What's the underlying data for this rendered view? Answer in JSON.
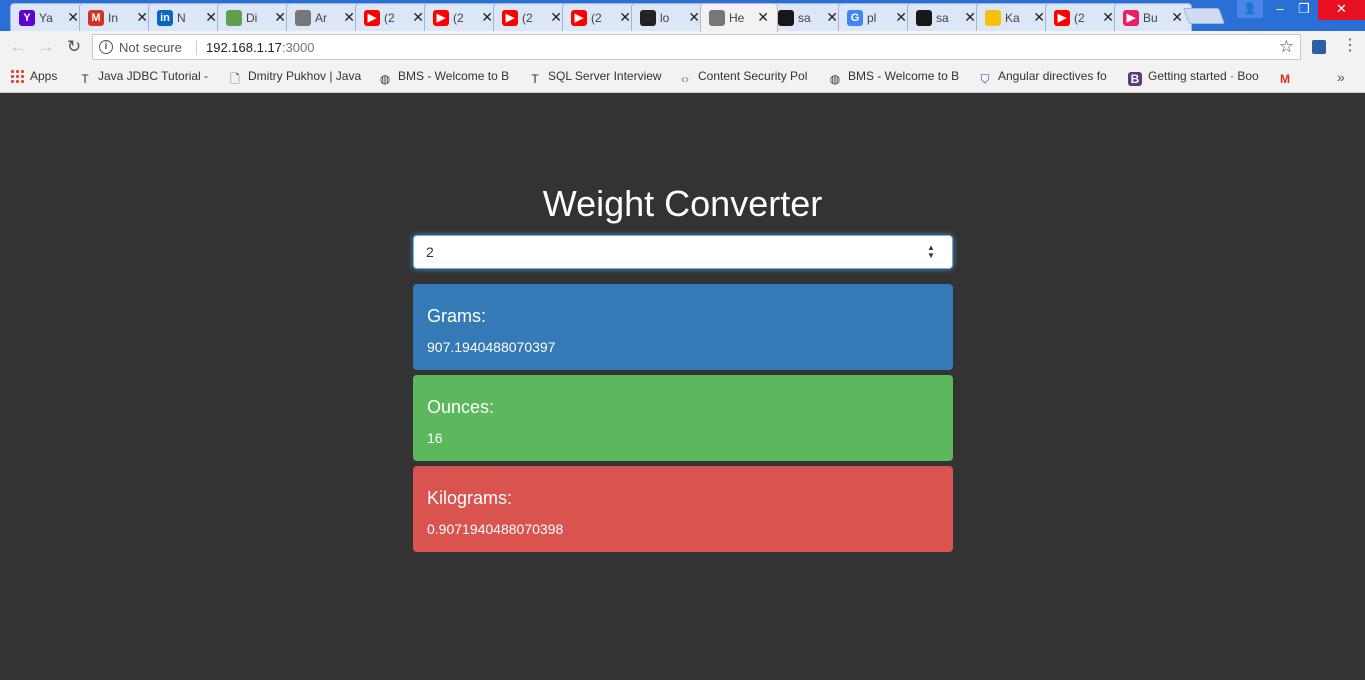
{
  "browser": {
    "tabs": [
      {
        "title": "Ya",
        "favicon": "yahoo-icon",
        "color": "#5f01d1",
        "glyph": "Y"
      },
      {
        "title": "In",
        "favicon": "gmail-icon",
        "color": "#d93025",
        "glyph": "M"
      },
      {
        "title": "N",
        "favicon": "linkedin-icon",
        "color": "#0a66c2",
        "glyph": "in"
      },
      {
        "title": "Di",
        "favicon": "nodejs-icon",
        "color": "#5fa04e",
        "glyph": ""
      },
      {
        "title": "Ar",
        "favicon": "bot-icon",
        "color": "#777777",
        "glyph": ""
      },
      {
        "title": "(2",
        "favicon": "youtube-icon",
        "color": "#ff0000",
        "glyph": "▶"
      },
      {
        "title": "(2",
        "favicon": "youtube-icon",
        "color": "#ff0000",
        "glyph": "▶"
      },
      {
        "title": "(2",
        "favicon": "youtube-icon",
        "color": "#ff0000",
        "glyph": "▶"
      },
      {
        "title": "(2",
        "favicon": "youtube-icon",
        "color": "#ff0000",
        "glyph": "▶"
      },
      {
        "title": "lo",
        "favicon": "loader-icon",
        "color": "#222222",
        "glyph": ""
      },
      {
        "title": "He",
        "favicon": "bot-icon",
        "color": "#777777",
        "glyph": "",
        "active": true
      },
      {
        "title": "sa",
        "favicon": "github-icon",
        "color": "#181717",
        "glyph": ""
      },
      {
        "title": "pl",
        "favicon": "google-icon",
        "color": "#4285f4",
        "glyph": "G"
      },
      {
        "title": "sa",
        "favicon": "github-icon",
        "color": "#181717",
        "glyph": ""
      },
      {
        "title": "Ka",
        "favicon": "bulb-icon",
        "color": "#f4c20d",
        "glyph": ""
      },
      {
        "title": "(2",
        "favicon": "youtube-icon",
        "color": "#ff0000",
        "glyph": "▶"
      },
      {
        "title": "Bu",
        "favicon": "media-icon",
        "color": "#e91e63",
        "glyph": "▶"
      }
    ],
    "security_label": "Not secure",
    "url_host": "192.168.1.17",
    "url_port": ":3000",
    "bookmarks": [
      {
        "label": "Apps",
        "icon": "apps-grid-icon"
      },
      {
        "label": "Java JDBC Tutorial -",
        "icon": "text-t-icon"
      },
      {
        "label": "Dmitry Pukhov | Java",
        "icon": "page-icon"
      },
      {
        "label": "BMS - Welcome to B",
        "icon": "globe-icon"
      },
      {
        "label": "SQL Server Interview",
        "icon": "text-t-icon"
      },
      {
        "label": "Content Security Pol",
        "icon": "brackets-icon"
      },
      {
        "label": "BMS - Welcome to B",
        "icon": "globe-icon"
      },
      {
        "label": "Angular directives fo",
        "icon": "shield-icon"
      },
      {
        "label": "Getting started · Boo",
        "icon": "bootstrap-icon"
      },
      {
        "label": "",
        "icon": "gmail-icon"
      }
    ]
  },
  "app": {
    "title": "Weight Converter",
    "input_value": "2",
    "results": [
      {
        "label": "Grams:",
        "value": "907.1940488070397",
        "color": "#337ab7"
      },
      {
        "label": "Ounces:",
        "value": "16",
        "color": "#5cb85c"
      },
      {
        "label": "Kilograms:",
        "value": "0.9071940488070398",
        "color": "#d9534f"
      }
    ]
  }
}
